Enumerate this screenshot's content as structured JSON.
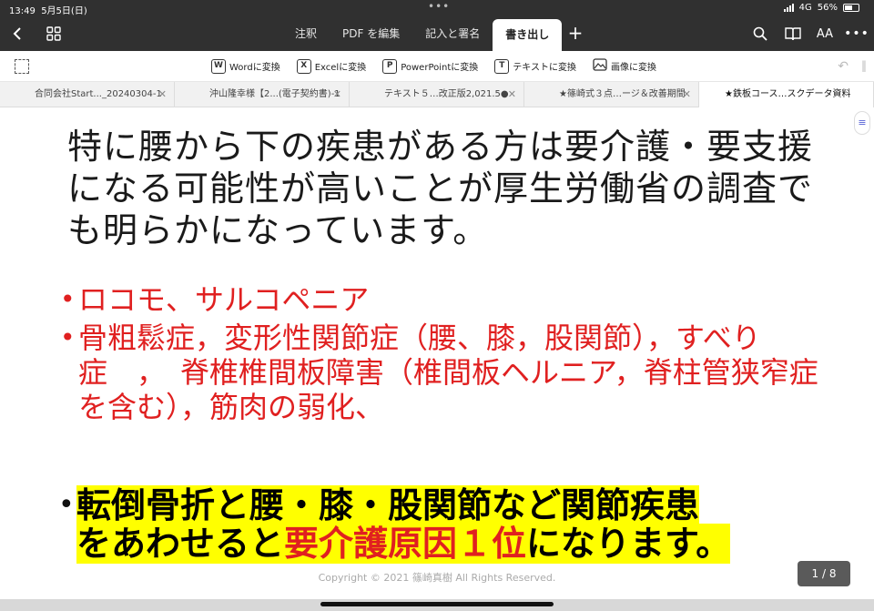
{
  "status": {
    "time": "13:49",
    "date": "5月5日(日)",
    "network": "4G",
    "battery": "56%",
    "battery_level": 0.56
  },
  "toolbar": {
    "tabs": [
      {
        "label": "注釈"
      },
      {
        "label": "PDF を編集"
      },
      {
        "label": "記入と署名"
      },
      {
        "label": "書き出し"
      }
    ],
    "active_tab": 3,
    "aa_label": "AA"
  },
  "convert": {
    "items": [
      {
        "icon_letter": "W",
        "label": "Wordに変換"
      },
      {
        "icon_letter": "X",
        "label": "Excelに変換"
      },
      {
        "icon_letter": "P",
        "label": "PowerPointに変換"
      },
      {
        "icon_letter": "T",
        "label": "テキストに変換"
      },
      {
        "icon_letter": "",
        "label": "画像に変換"
      }
    ]
  },
  "document_tabs": [
    {
      "label": "合同会社Start..._20240304-1"
    },
    {
      "label": "沖山隆幸様【2...(電子契約書)-1"
    },
    {
      "label": "テキスト５…改正版2,021.5●"
    },
    {
      "label": "★篠崎式３点…ージ＆改善期間"
    },
    {
      "label": "★鉄板コース…スクデータ資料"
    }
  ],
  "slide": {
    "heading": "特に腰から下の疾患がある方は要介護・要支援になる可能性が高いことが厚生労働省の調査でも明らかになっています。",
    "bullets": [
      {
        "text": "ロコモ、サルコペニア"
      },
      {
        "text": "骨粗鬆症，変形性関節症（腰、膝，股関節），すべり症　，　脊椎椎間板障害（椎間板ヘルニア，脊柱管狭窄症を含む），筋肉の弱化、"
      }
    ],
    "highlight": {
      "line1": "転倒骨折と腰・膝・股関節など関節疾患",
      "line2_a": "をあわせると",
      "line2_red": "要介護原因１位",
      "line2_b": "になります。"
    },
    "copyright": "Copyright © 2021 篠崎真樹 All Rights Reserved.",
    "page_indicator": "1 / 8"
  },
  "colors": {
    "topbar": "#303030",
    "red_text": "#e02020",
    "highlight": "#ffff00"
  }
}
